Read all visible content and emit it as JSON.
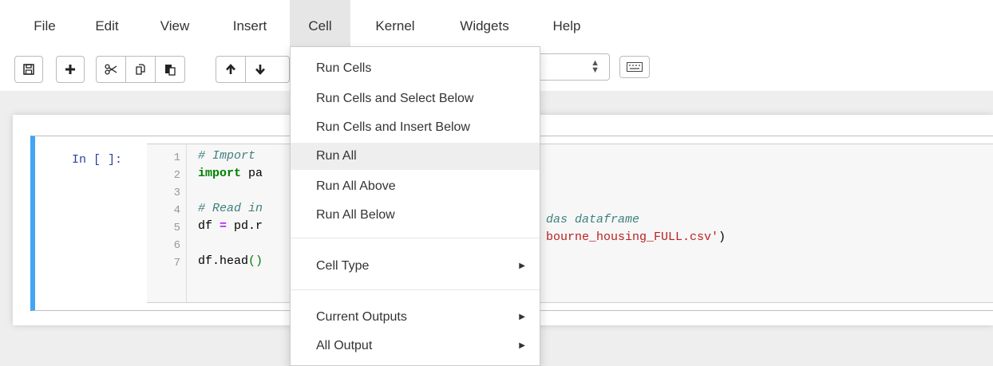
{
  "menubar": {
    "items": [
      {
        "label": "File"
      },
      {
        "label": "Edit"
      },
      {
        "label": "View"
      },
      {
        "label": "Insert"
      },
      {
        "label": "Cell"
      },
      {
        "label": "Kernel"
      },
      {
        "label": "Widgets"
      },
      {
        "label": "Help"
      }
    ],
    "active": "Cell"
  },
  "toolbar": {
    "buttons": [
      "save-icon",
      "plus-icon",
      "cut-icon",
      "copy-icon",
      "paste-icon",
      "arrow-up-icon",
      "arrow-down-icon"
    ],
    "cell_type_select": "",
    "keyboard_icon": "keyboard-icon"
  },
  "cell": {
    "prompt": "In [ ]:",
    "line_numbers": [
      "1",
      "2",
      "3",
      "4",
      "5",
      "6",
      "7"
    ],
    "lines": [
      {
        "parts": [
          {
            "cls": "cm-comment",
            "text": "# Import"
          }
        ]
      },
      {
        "parts": [
          {
            "cls": "cm-keyword",
            "text": "import"
          },
          {
            "cls": "",
            "text": " pa"
          }
        ]
      },
      {
        "parts": []
      },
      {
        "parts": [
          {
            "cls": "cm-comment",
            "text": "# Read in"
          }
        ]
      },
      {
        "parts": [
          {
            "cls": "",
            "text": "df "
          },
          {
            "cls": "cm-op",
            "text": "="
          },
          {
            "cls": "",
            "text": " pd.r"
          }
        ]
      },
      {
        "parts": []
      },
      {
        "parts": [
          {
            "cls": "",
            "text": "df.head"
          },
          {
            "cls": "cm-paren",
            "text": "()"
          }
        ]
      }
    ],
    "line4_tail": {
      "parts": [
        {
          "cls": "cm-comment",
          "text": "das dataframe"
        }
      ]
    },
    "line5_tail": {
      "parts": [
        {
          "cls": "cm-str",
          "text": "bourne_housing_FULL.csv'"
        },
        {
          "cls": "",
          "text": ")"
        }
      ]
    }
  },
  "dropdown": {
    "items": [
      {
        "label": "Run Cells"
      },
      {
        "label": "Run Cells and Select Below"
      },
      {
        "label": "Run Cells and Insert Below"
      },
      {
        "label": "Run All"
      },
      {
        "label": "Run All Above"
      },
      {
        "label": "Run All Below"
      },
      {
        "label": "Cell Type"
      },
      {
        "label": "Current Outputs"
      },
      {
        "label": "All Output"
      }
    ],
    "hovered": "Run All"
  }
}
